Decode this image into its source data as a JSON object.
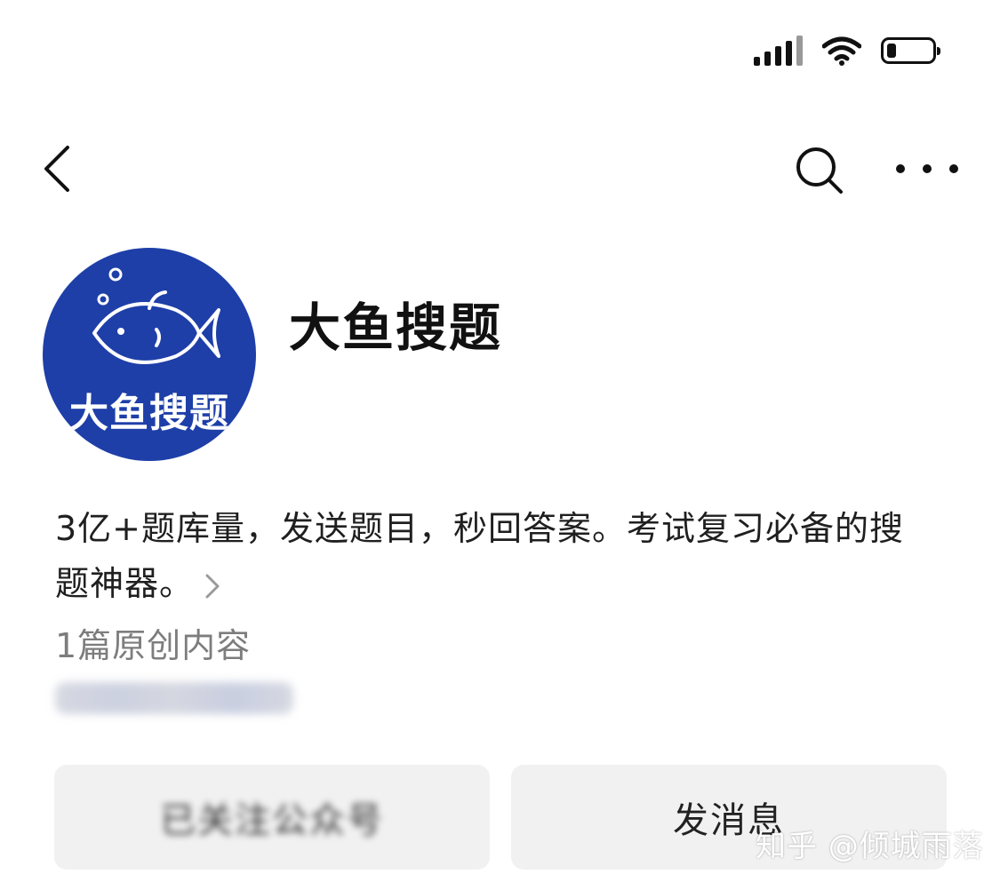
{
  "header": {
    "back_icon": "chevron-left-icon",
    "search_icon": "search-icon",
    "more_icon": "more-horizontal-icon"
  },
  "status_bar": {
    "icons": [
      "signal-icon",
      "wifi-icon",
      "battery-icon"
    ]
  },
  "profile": {
    "name": "大鱼搜题",
    "avatar_text": "大鱼搜题",
    "avatar_color": "#1e3fa8",
    "description": "3亿+题库量，发送题目，秒回答案。考试复习必备的搜题神器。",
    "original_count": "1篇原创内容"
  },
  "actions": {
    "follow_label": "已关注公众号",
    "message_label": "发消息"
  },
  "watermark": "知乎 @倾城雨落"
}
